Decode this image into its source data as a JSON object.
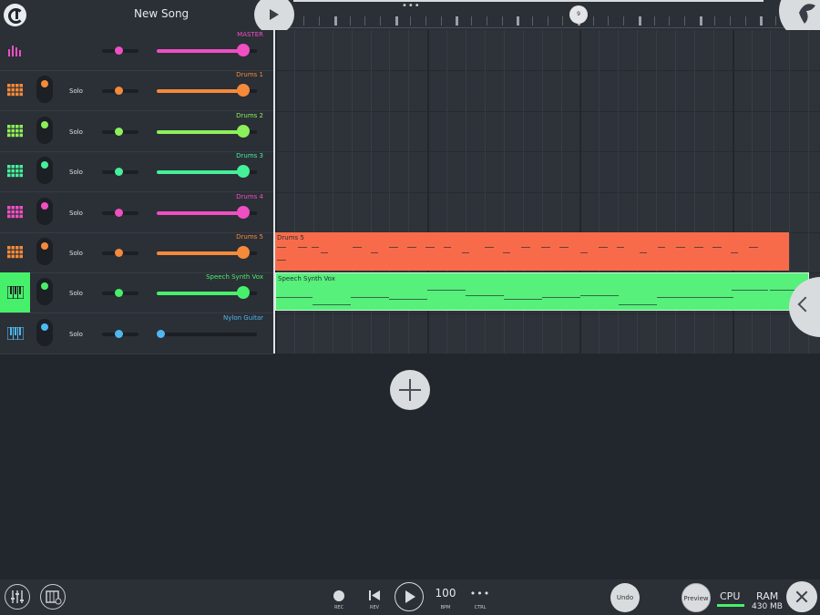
{
  "header": {
    "song_title": "New Song"
  },
  "timeline": {
    "position_label": "9",
    "more_label": "•••"
  },
  "colors": {
    "pink": "#ef4fc3",
    "orange": "#f58a3b",
    "lime": "#8cf05a",
    "mint": "#45f09a",
    "green": "#47f06a",
    "blue": "#4fb8f0",
    "clip_orange": "#f86b4a",
    "clip_green": "#56f07b"
  },
  "tracks": [
    {
      "name": "MASTER",
      "solo": "",
      "color": "#ef4fc3",
      "icon": "mixer-icon",
      "volume": 0.86,
      "has_knob": false
    },
    {
      "name": "Drums 1",
      "solo": "Solo",
      "color": "#f58a3b",
      "icon": "drum-pads-icon",
      "volume": 0.86,
      "has_knob": true
    },
    {
      "name": "Drums 2",
      "solo": "Solo",
      "color": "#8cf05a",
      "icon": "drum-pads-icon",
      "volume": 0.86,
      "has_knob": true
    },
    {
      "name": "Drums 3",
      "solo": "Solo",
      "color": "#45f09a",
      "icon": "drum-pads-icon",
      "volume": 0.86,
      "has_knob": true
    },
    {
      "name": "Drums 4",
      "solo": "Solo",
      "color": "#ef4fc3",
      "icon": "drum-pads-icon",
      "volume": 0.86,
      "has_knob": true
    },
    {
      "name": "Drums 5",
      "solo": "Solo",
      "color": "#f58a3b",
      "icon": "drum-pads-icon",
      "volume": 0.86,
      "has_knob": true
    },
    {
      "name": "Speech Synth Vox",
      "solo": "Solo",
      "color": "#47f06a",
      "icon": "piano-keys-icon",
      "volume": 0.86,
      "has_knob": true,
      "selected": true
    },
    {
      "name": "Nylon Guitar",
      "solo": "Solo",
      "color": "#4fb8f0",
      "icon": "piano-keys-icon",
      "volume": 0.0,
      "has_knob": true
    }
  ],
  "clips": [
    {
      "label": "Drums 5",
      "color": "#f86b4a"
    },
    {
      "label": "Speech Synth Vox",
      "color": "#56f07b"
    }
  ],
  "transport": {
    "rec_label": "REC",
    "rev_label": "REV",
    "bpm_value": "100",
    "bpm_label": "BPM",
    "ctrl_dots": "•••",
    "ctrl_label": "CTRL",
    "undo_label": "Undo",
    "preview_label": "Preview",
    "cpu_label": "CPU",
    "ram_label": "RAM",
    "ram_value": "430 MB"
  }
}
